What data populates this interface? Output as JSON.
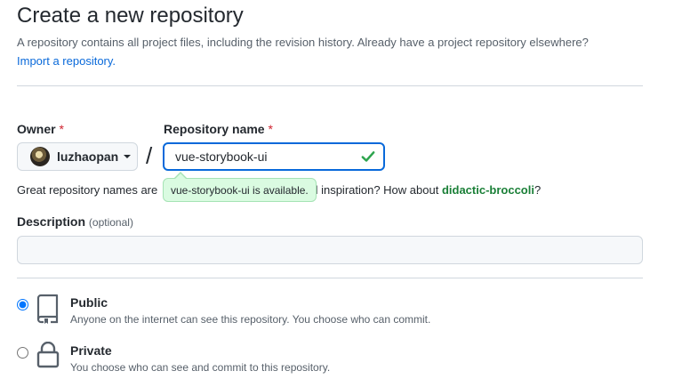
{
  "page": {
    "title": "Create a new repository",
    "subtitle": "A repository contains all project files, including the revision history. Already have a project repository elsewhere?",
    "import_link": "Import a repository."
  },
  "owner": {
    "label": "Owner",
    "required_mark": "*",
    "selected": "luzhaopan"
  },
  "slash": "/",
  "repo_name": {
    "label": "Repository name",
    "required_mark": "*",
    "value": "vue-storybook-ui",
    "available_tooltip": "vue-storybook-ui is available.",
    "status_icon": "check-icon"
  },
  "hint": {
    "prefix": "Great repository names are",
    "middle": "d inspiration? How about",
    "suggestion": "didactic-broccoli",
    "suffix": "?"
  },
  "description": {
    "label": "Description",
    "optional": "(optional)",
    "value": "",
    "placeholder": ""
  },
  "visibility": {
    "selected": "public",
    "options": [
      {
        "id": "public",
        "label": "Public",
        "description": "Anyone on the internet can see this repository. You choose who can commit.",
        "icon": "repo-icon"
      },
      {
        "id": "private",
        "label": "Private",
        "description": "You choose who can see and commit to this repository.",
        "icon": "lock-icon"
      }
    ]
  },
  "colors": {
    "link": "#0969da",
    "success": "#1a7f37",
    "required": "#cf222e",
    "tooltip_bg": "#dafbe1"
  }
}
